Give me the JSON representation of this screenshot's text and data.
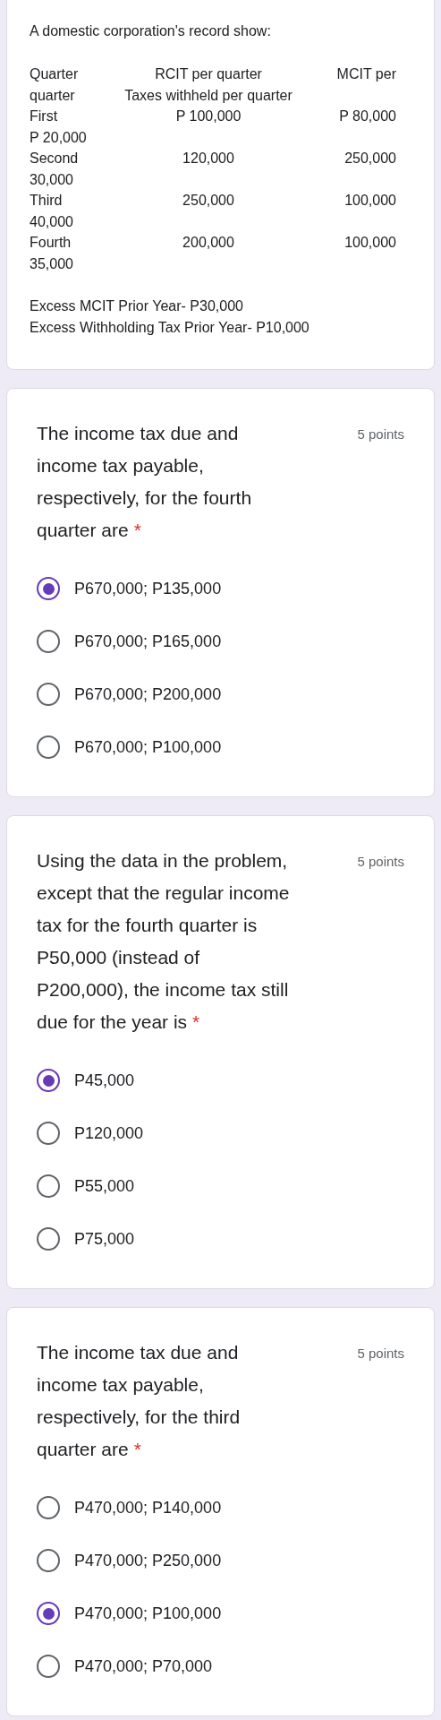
{
  "description": {
    "intro": "A domestic corporation's record show:",
    "table_lines": [
      {
        "column_1": "Quarter",
        "column_2": "RCIT per quarter",
        "column_3": "MCIT per"
      },
      {
        "column_1": "quarter",
        "column_2": "Taxes withheld per quarter"
      },
      {
        "column_1": "First",
        "column_2": "P 100,000",
        "column_3": "P 80,000"
      },
      {
        "column_1": "P 20,000"
      },
      {
        "column_1": "Second",
        "column_2": "120,000",
        "column_3": "250,000"
      },
      {
        "column_1": "30,000"
      },
      {
        "column_1": "Third",
        "column_2": "250,000",
        "column_3": "100,000"
      },
      {
        "column_1": "40,000"
      },
      {
        "column_1": "Fourth",
        "column_2": "200,000",
        "column_3": "100,000"
      },
      {
        "column_1": "35,000"
      }
    ],
    "notes": [
      "Excess MCIT Prior Year- P30,000",
      "Excess Withholding Tax Prior Year- P10,000"
    ]
  },
  "questions": [
    {
      "text": "The income tax due and income tax payable, respectively, for the fourth quarter are",
      "required_mark": "*",
      "points": "5 points",
      "options": [
        {
          "label": "P670,000; P135,000",
          "selected": true
        },
        {
          "label": "P670,000; P165,000",
          "selected": false
        },
        {
          "label": "P670,000; P200,000",
          "selected": false
        },
        {
          "label": "P670,000; P100,000",
          "selected": false
        }
      ]
    },
    {
      "text": "Using the data in the problem, except that the regular income tax for the fourth quarter is P50,000 (instead of P200,000), the income tax still due for the year is",
      "required_mark": "*",
      "points": "5 points",
      "options": [
        {
          "label": "P45,000",
          "selected": true
        },
        {
          "label": "P120,000",
          "selected": false
        },
        {
          "label": "P55,000",
          "selected": false
        },
        {
          "label": "P75,000",
          "selected": false
        }
      ]
    },
    {
      "text": "The income tax due and income tax payable, respectively, for the third quarter are",
      "required_mark": "*",
      "points": "5 points",
      "options": [
        {
          "label": "P470,000; P140,000",
          "selected": false
        },
        {
          "label": "P470,000; P250,000",
          "selected": false
        },
        {
          "label": "P470,000; P100,000",
          "selected": true
        },
        {
          "label": "P470,000; P70,000",
          "selected": false
        }
      ]
    }
  ]
}
